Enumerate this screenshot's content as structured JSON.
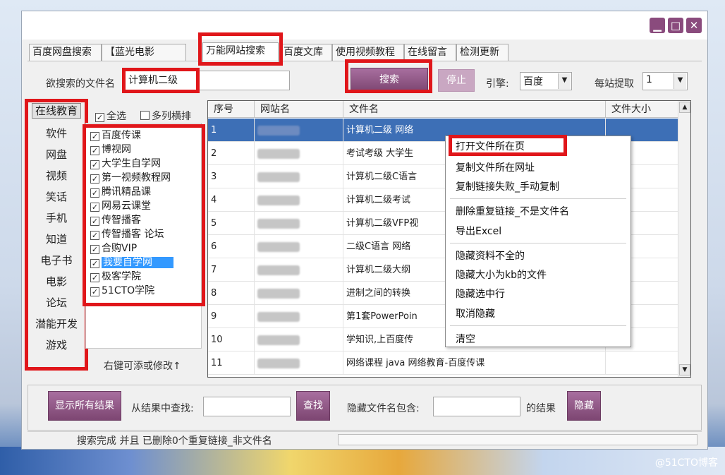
{
  "window": {
    "controls": [
      "▁",
      "□",
      "✕"
    ]
  },
  "tabs": [
    "百度网盘搜索",
    "【蓝光电影",
    "万能网站搜索",
    "百度文库",
    "使用视频教程",
    "在线留言",
    "检测更新"
  ],
  "search": {
    "label": "欲搜索的文件名",
    "value": "计算机二级",
    "search_button": "搜索",
    "stop_button": "停止",
    "engine_label": "引擎:",
    "engine_value": "百度",
    "per_site_label": "每站提取",
    "per_site_value": "1"
  },
  "categories": [
    "在线教育",
    "软件",
    "网盘",
    "视频",
    "笑话",
    "手机",
    "知道",
    "电子书",
    "电影",
    "论坛",
    "潜能开发",
    "游戏"
  ],
  "site_options": {
    "select_all": "全选",
    "multi_column": "多列横排"
  },
  "sites": [
    "百度传课",
    "博视网",
    "大学生自学网",
    "第一视频教程网",
    "腾讯精品课",
    "网易云课堂",
    "传智播客",
    "传智播客 论坛",
    "合购VIP",
    "我要自学网",
    "极客学院",
    "51CTO学院"
  ],
  "right_click_hint": "右键可添或修改↑",
  "table": {
    "headers": [
      "序号",
      "网站名",
      "文件名",
      "文件大小"
    ],
    "rows": [
      {
        "no": "1",
        "site": "",
        "file": "计算机二级 网络"
      },
      {
        "no": "2",
        "site": "",
        "file": "考试考级 大学生"
      },
      {
        "no": "3",
        "site": "",
        "file": "计算机二级C语言"
      },
      {
        "no": "4",
        "site": "",
        "file": "计算机二级考试"
      },
      {
        "no": "5",
        "site": "",
        "file": "计算机二级VFP视"
      },
      {
        "no": "6",
        "site": "",
        "file": "二级C语言 网络"
      },
      {
        "no": "7",
        "site": "",
        "file": "计算机二级大纲"
      },
      {
        "no": "8",
        "site": "",
        "file": "进制之间的转换"
      },
      {
        "no": "9",
        "site": "",
        "file": "第1套PowerPoin"
      },
      {
        "no": "10",
        "site": "",
        "file": "学知识,上百度传"
      },
      {
        "no": "11",
        "site": "",
        "file": "网络课程 java 网络教育-百度传课"
      }
    ]
  },
  "context_menu": [
    "打开文件所在页",
    "复制文件所在网址",
    "复制链接失败_手动复制",
    "删除重复链接_不是文件名",
    "导出Excel",
    "隐藏资料不全的",
    "隐藏大小为kb的文件",
    "隐藏选中行",
    "取消隐藏",
    "清空"
  ],
  "bottom": {
    "show_all": "显示所有结果",
    "find_label": "从结果中查找:",
    "find_button": "查找",
    "hide_label": "隐藏文件名包含:",
    "result_label": "的结果",
    "hide_button": "隐藏"
  },
  "status": {
    "text": "搜索完成 并且 已删除0个重复链接_非文件名"
  },
  "watermark": "@51CTO博客",
  "colors": {
    "accent": "#8a4b7d",
    "highlight_box": "#e0161a",
    "selected_row": "#3d6fb6"
  }
}
